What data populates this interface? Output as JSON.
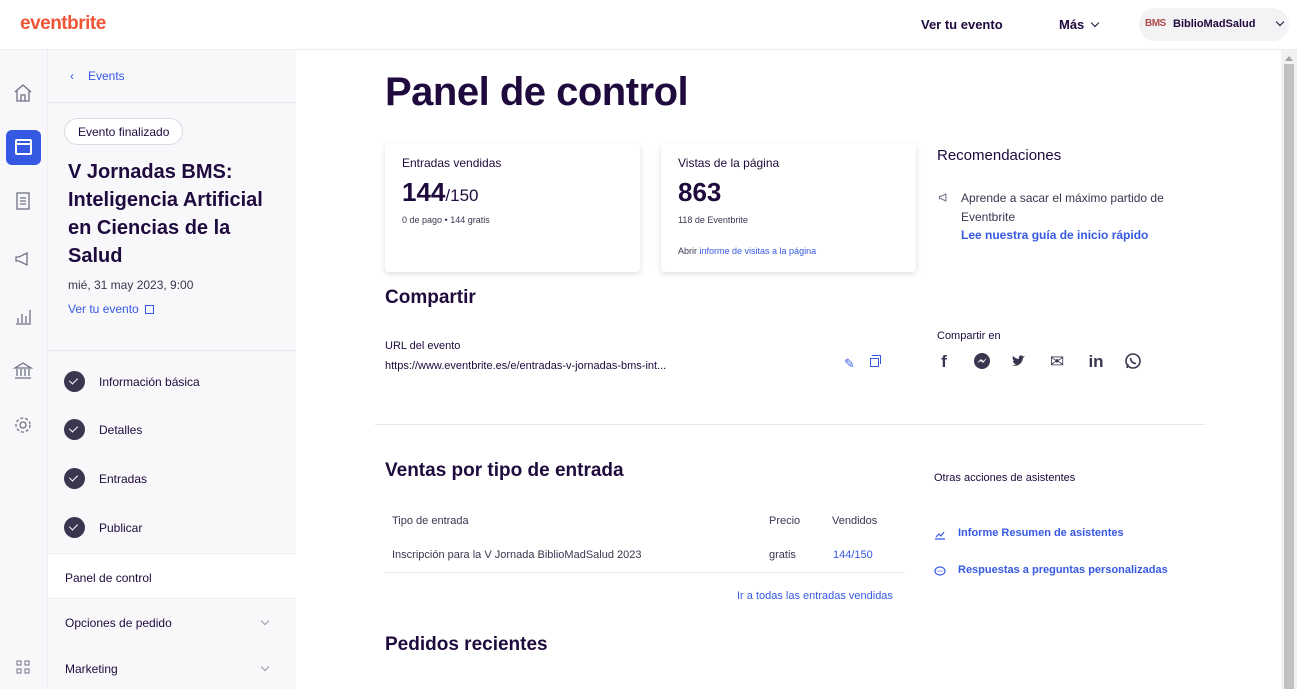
{
  "topbar": {
    "logo": "eventbrite",
    "view_event": "Ver tu evento",
    "more": "Más",
    "org_logo": "BMS",
    "org_name": "BiblioMadSalud"
  },
  "rail": {
    "icons": [
      "home-icon",
      "calendar-icon",
      "orders-icon",
      "megaphone-icon",
      "reports-icon",
      "finance-icon",
      "settings-icon",
      "apps-icon"
    ]
  },
  "sidebar": {
    "back_label": "Events",
    "status": "Evento finalizado",
    "event_title": "V Jornadas BMS: Inteligencia Artificial en Ciencias de la Salud",
    "event_date": "mié, 31 may 2023, 9:00",
    "view_event": "Ver tu evento",
    "steps": [
      "Información básica",
      "Detalles",
      "Entradas",
      "Publicar"
    ],
    "nav": [
      "Panel de control",
      "Opciones de pedido",
      "Marketing"
    ]
  },
  "main": {
    "title": "Panel de control",
    "tickets_card": {
      "label": "Entradas vendidas",
      "value": "144",
      "total": "/150",
      "sub": "0 de pago • 144 gratis"
    },
    "views_card": {
      "label": "Vistas de la página",
      "value": "863",
      "sub": "118 de Eventbrite",
      "link_prefix": "Abrir ",
      "link": "informe de visitas a la página"
    },
    "recommendations": {
      "title": "Recomendaciones",
      "text": "Aprende a sacar el máximo partido de Eventbrite",
      "link": "Lee nuestra guía de inicio rápido"
    },
    "share": {
      "title": "Compartir",
      "url_label": "URL del evento",
      "url": "https://www.eventbrite.es/e/entradas-v-jornadas-bms-int...",
      "share_on": "Compartir en",
      "social": [
        "f",
        "m",
        "t",
        "✉",
        "in",
        "w"
      ]
    },
    "sales": {
      "title": "Ventas por tipo de entrada",
      "headers": [
        "Tipo de entrada",
        "Precio",
        "Vendidos"
      ],
      "row": [
        "Inscripción para la V Jornada BiblioMadSalud 2023",
        "gratis",
        "144/150"
      ],
      "all_link": "Ir a todas las entradas vendidas"
    },
    "other_actions": {
      "title": "Otras acciones de asistentes",
      "links": [
        "Informe Resumen de asistentes",
        "Respuestas a preguntas personalizadas"
      ]
    },
    "recent_orders": {
      "title": "Pedidos recientes"
    }
  },
  "colors": {
    "brand": "#f05537",
    "accent": "#3659e3",
    "text": "#1e0a3c"
  }
}
